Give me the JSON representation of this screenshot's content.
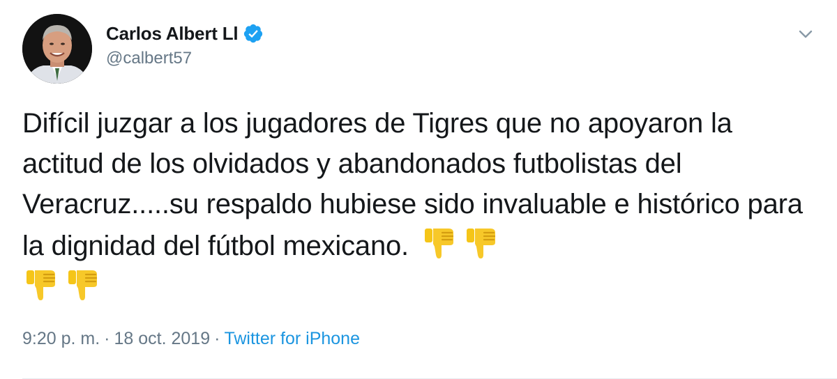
{
  "author": {
    "display_name": "Carlos Albert Ll",
    "handle": "@calbert57",
    "verified": true
  },
  "tweet": {
    "text": "Difícil juzgar a los jugadores de Tigres que no apoyaron la actitud de los olvidados y abandonados futbolistas del Veracruz.....su respaldo hubiese sido invaluable e histórico para la dignidad del fútbol mexicano.",
    "emojis": [
      "thumbs-down",
      "thumbs-down",
      "thumbs-down",
      "thumbs-down"
    ]
  },
  "meta": {
    "time": "9:20 p. m.",
    "separator": "·",
    "date": "18 oct. 2019",
    "separator2": "·",
    "source": "Twitter for iPhone"
  },
  "colors": {
    "link": "#1b95e0",
    "verified": "#1da1f2",
    "muted": "#657786",
    "text": "#14171a",
    "emoji": "#f5c518"
  }
}
